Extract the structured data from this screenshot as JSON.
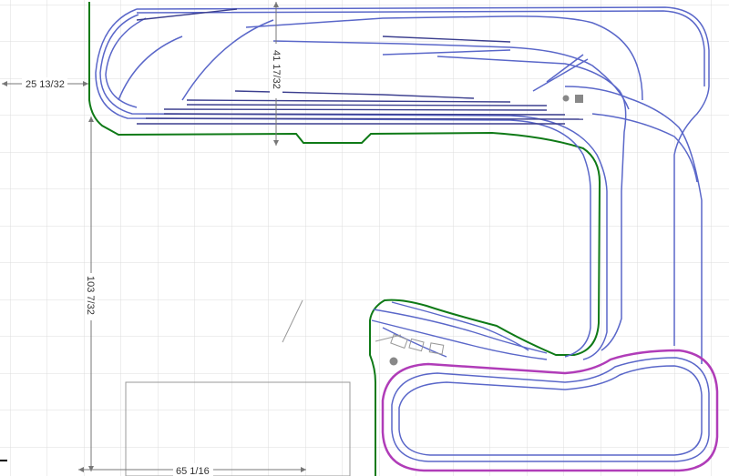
{
  "app": {
    "type": "track-planner"
  },
  "dimensions": {
    "left_offset": "25 13/32",
    "top_height": "41 17/32",
    "left_height": "103 7/32",
    "bottom_width": "65 1/16"
  },
  "colors": {
    "grid": "#dcdcdc",
    "track": "#5a67c9",
    "track_dark": "#3c3f8f",
    "benchwork": "#0f7a17",
    "loop": "#b03cb8",
    "dimension_line": "#777777",
    "structure": "#999999"
  },
  "icons": [
    "dimension-arrow-icon",
    "crosshair-icon"
  ]
}
